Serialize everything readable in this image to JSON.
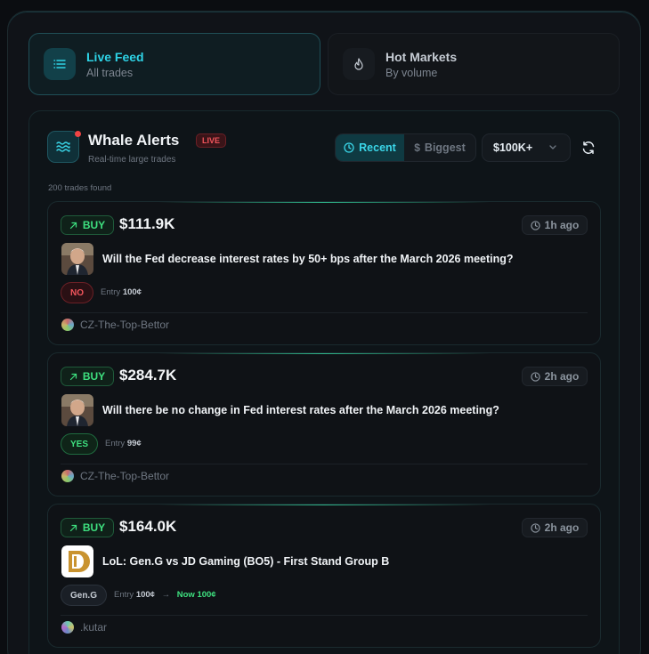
{
  "tabs": [
    {
      "title": "Live Feed",
      "subtitle": "All trades",
      "icon": "list-icon",
      "active": true
    },
    {
      "title": "Hot Markets",
      "subtitle": "By volume",
      "icon": "flame-icon",
      "active": false
    }
  ],
  "whale": {
    "title": "Whale Alerts",
    "live_badge": "LIVE",
    "subtitle": "Real-time large trades",
    "sort_recent": "Recent",
    "sort_biggest": "Biggest",
    "filter_value": "$100K+",
    "count_text": "200 trades found"
  },
  "trades": [
    {
      "side": "BUY",
      "amount": "$111.9K",
      "time": "1h ago",
      "question": "Will the Fed decrease interest rates by 50+ bps after the March 2026 meeting?",
      "outcome": "NO",
      "entry_label": "Entry",
      "entry_value": "100¢",
      "user": "CZ-The-Top-Bettor"
    },
    {
      "side": "BUY",
      "amount": "$284.7K",
      "time": "2h ago",
      "question": "Will there be no change in Fed interest rates after the March 2026 meeting?",
      "outcome": "YES",
      "entry_label": "Entry",
      "entry_value": "99¢",
      "user": "CZ-The-Top-Bettor"
    },
    {
      "side": "BUY",
      "amount": "$164.0K",
      "time": "2h ago",
      "question": "LoL: Gen.G vs JD Gaming (BO5) - First Stand Group B",
      "outcome": "Gen.G",
      "entry_label": "Entry",
      "entry_value": "100¢",
      "arrow": "→",
      "now_text": "Now 100¢",
      "user": ".kutar"
    }
  ],
  "colors": {
    "accent": "#2ed3e6",
    "buy": "#3ee07f",
    "no": "#f2555c",
    "background": "#0b0d11"
  }
}
